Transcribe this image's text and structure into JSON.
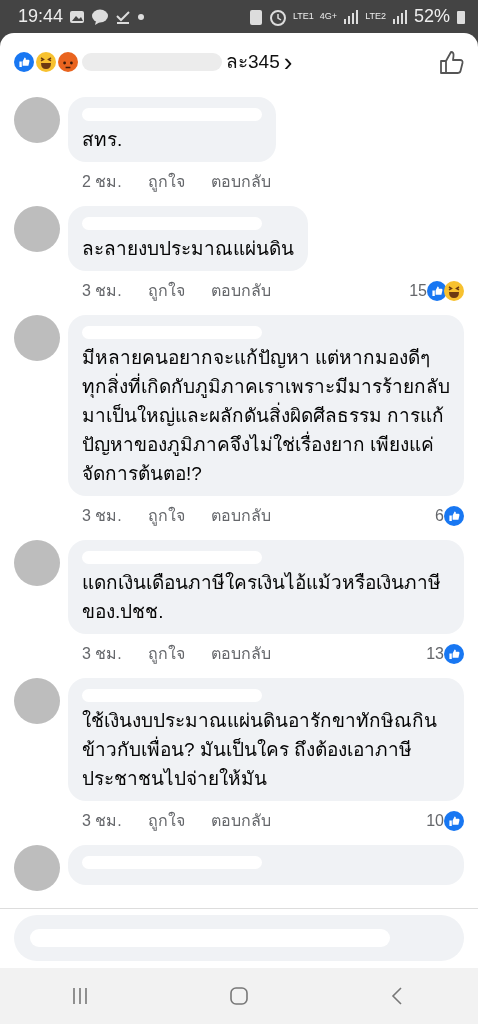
{
  "status_bar": {
    "time": "19:44",
    "network_1": "LTE1",
    "network_2": "LTE2",
    "network_type": "4G+",
    "battery": "52%"
  },
  "header": {
    "reactions": [
      {
        "kind": "like"
      },
      {
        "kind": "haha"
      },
      {
        "kind": "angry"
      }
    ],
    "summary": "ละ345",
    "chevron": "›"
  },
  "comments": [
    {
      "kind": "full",
      "text": "สทร.",
      "time": "2 ชม.",
      "like_label": "ถูกใจ",
      "reply_label": "ตอบกลับ"
    },
    {
      "kind": "full",
      "text": "ละลายงบประมาณแผ่นดิน",
      "time": "3 ชม.",
      "like_label": "ถูกใจ",
      "reply_label": "ตอบกลับ",
      "reaction_count": "15",
      "reactions": [
        {
          "kind": "like"
        },
        {
          "kind": "haha"
        }
      ]
    },
    {
      "kind": "full",
      "text": "มีหลายคนอยากจะแก้ปัญหา แต่หากมองดีๆ ทุกสิ่งที่เกิดกับภูมิภาคเราเพราะมีมารร้ายกลับมาเป็นใหญ่และผลักดันสิ่งผิดศีลธรรม การแก้ปัญหาของภูมิภาคจึงไม่ใช่เรื่องยาก เพียงแค่จัดการต้นตอ!?",
      "time": "3 ชม.",
      "like_label": "ถูกใจ",
      "reply_label": "ตอบกลับ",
      "reaction_count": "6",
      "reactions": [
        {
          "kind": "like"
        }
      ]
    },
    {
      "kind": "full",
      "text": "แดกเงินเดือนภาษีใครเงินไอ้แม้วหรือเงินภาษีของ.ปชช.",
      "time": "3 ชม.",
      "like_label": "ถูกใจ",
      "reply_label": "ตอบกลับ",
      "reaction_count": "13",
      "reactions": [
        {
          "kind": "like"
        }
      ]
    },
    {
      "kind": "full",
      "text": "ใช้เงินงบประมาณแผ่นดินอารักขาทักษิณกินข้าวกับเพื่อน? มันเป็นใคร ถึงต้องเอาภาษีประชาชนไปจ่ายให้มัน",
      "time": "3 ชม.",
      "like_label": "ถูกใจ",
      "reply_label": "ตอบกลับ",
      "reaction_count": "10",
      "reactions": [
        {
          "kind": "like"
        }
      ]
    },
    {
      "kind": "partial"
    }
  ]
}
